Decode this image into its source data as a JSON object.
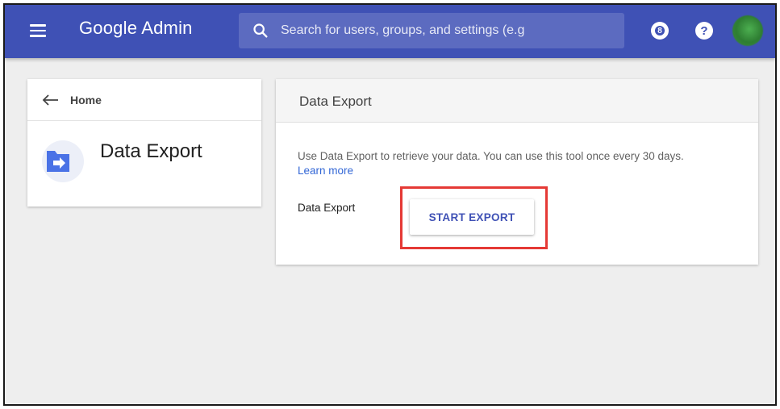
{
  "app": {
    "title": "Google Admin",
    "accent_color": "#3f51b5"
  },
  "header": {
    "menu_icon": "hamburger-menu-icon",
    "search": {
      "placeholder": "Search for users, groups, and settings (e.g",
      "value": "",
      "icon": "search-icon"
    },
    "notification_badge": "8",
    "help_icon": "?",
    "avatar_icon": "avatar"
  },
  "sidebar": {
    "breadcrumb_label": "Home",
    "back_icon": "arrow-left-icon",
    "page_title": "Data Export",
    "page_icon": "folder-export-icon"
  },
  "main": {
    "card_title": "Data Export",
    "description": "Use Data Export to retrieve your data. You can use this tool once every 30 days.",
    "learn_more": "Learn more",
    "row_label": "Data Export",
    "start_button": "START EXPORT",
    "highlight_color": "#e53935"
  }
}
